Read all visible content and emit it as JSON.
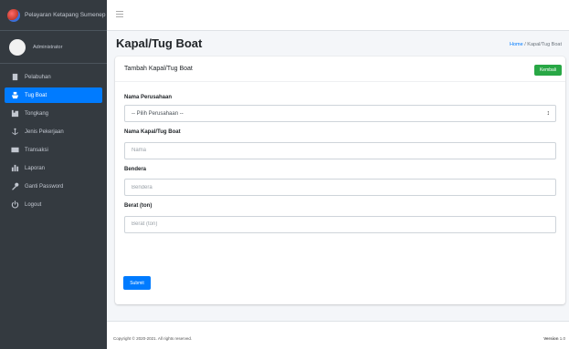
{
  "brand": {
    "name": "Pelayaran Ketapang Sumenep"
  },
  "user": {
    "name": "Administrator"
  },
  "sidebar": {
    "items": [
      {
        "label": "Pelabuhan",
        "icon": "building-icon",
        "active": false
      },
      {
        "label": "Tug Boat",
        "icon": "ship-icon",
        "active": true
      },
      {
        "label": "Tongkang",
        "icon": "barge-icon",
        "active": false
      },
      {
        "label": "Jenis Pekerjaan",
        "icon": "anchor-icon",
        "active": false
      },
      {
        "label": "Transaksi",
        "icon": "id-card-icon",
        "active": false
      },
      {
        "label": "Laporan",
        "icon": "chart-icon",
        "active": false
      },
      {
        "label": "Ganti Password",
        "icon": "key-icon",
        "active": false
      },
      {
        "label": "Logout",
        "icon": "power-icon",
        "active": false
      }
    ]
  },
  "header": {
    "title": "Kapal/Tug Boat",
    "breadcrumb_home": "Home",
    "breadcrumb_sep": " / ",
    "breadcrumb_current": "Kapal/Tug Boat"
  },
  "card": {
    "title": "Tambah Kapal/Tug Boat",
    "back_label": "Kembali"
  },
  "form": {
    "perusahaan_label": "Nama Perusahaan",
    "perusahaan_value": "-- Pilih Perusahaan --",
    "kapal_label": "Nama Kapal/Tug Boat",
    "kapal_placeholder": "Nama",
    "bendera_label": "Bendera",
    "bendera_placeholder": "Bendera",
    "berat_label": "Berat (ton)",
    "berat_placeholder": "Berat (ton)",
    "submit_label": "Submit"
  },
  "footer": {
    "copyright": "Copyright © 2020-2021. All rights reserved.",
    "version_label": "Version",
    "version_value": "1.0"
  },
  "colors": {
    "sidebar_bg": "#343a40",
    "active": "#007bff",
    "success": "#28a745"
  }
}
